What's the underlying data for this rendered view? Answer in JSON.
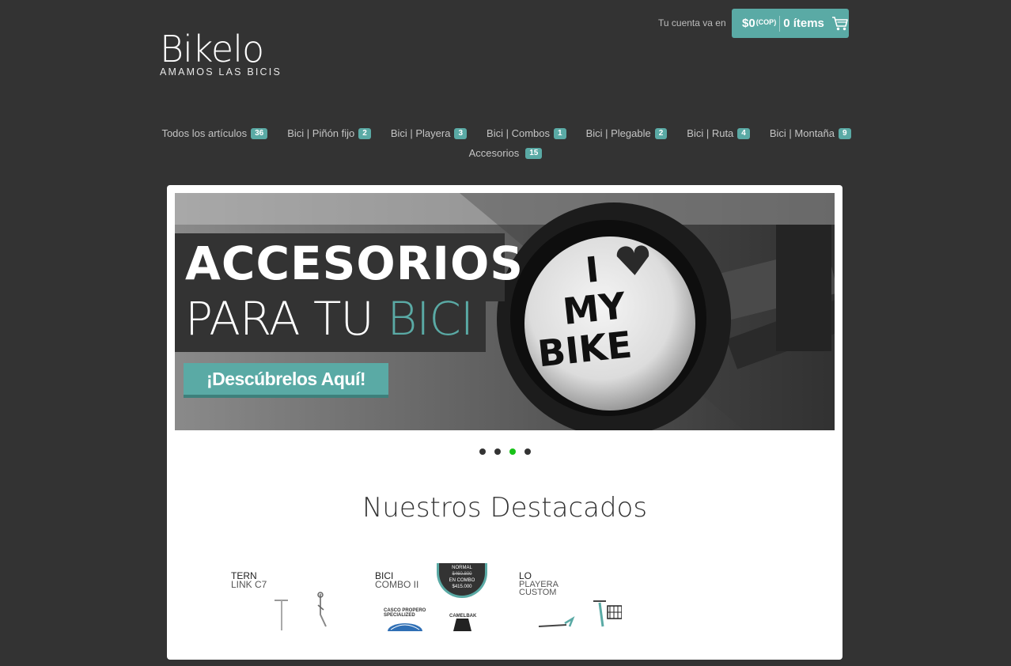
{
  "header": {
    "logo_text": "Bikelo",
    "logo_tagline": "AMAMOS LAS BICIS",
    "account_label": "Tu cuenta va en",
    "cart_amount": "$0",
    "cart_currency": "(COP)",
    "cart_items": "0 ítems"
  },
  "nav": {
    "row1": [
      {
        "label": "Todos los artículos",
        "count": "36"
      },
      {
        "label": "Bici | Piñón fijo",
        "count": "2"
      },
      {
        "label": "Bici | Playera",
        "count": "3"
      },
      {
        "label": "Bici | Combos",
        "count": "1"
      },
      {
        "label": "Bici | Plegable",
        "count": "2"
      },
      {
        "label": "Bici | Ruta",
        "count": "4"
      },
      {
        "label": "Bici | Montaña",
        "count": "9"
      }
    ],
    "row2": [
      {
        "label": "Accesorios",
        "count": "15"
      }
    ]
  },
  "slider": {
    "headline_1": "ACCESORIOS",
    "headline_2a": "PARA TU ",
    "headline_2b": "BICI",
    "bell_text_1": "I",
    "bell_text_2": "MY",
    "bell_text_3": "BIKE",
    "cta_label": "¡Descúbrelos Aquí!",
    "active_slide": 3,
    "slide_count": 4
  },
  "featured": {
    "title": "Nuestros Destacados",
    "products": [
      {
        "line1": "TERN",
        "line2": "LINK C7"
      },
      {
        "line1": "BICI",
        "line2": "COMBO II",
        "badge_1": "NORMAL",
        "badge_2": "$460.800",
        "badge_3": "EN COMBO",
        "badge_4": "$415.000",
        "item_a_1": "CASCO PROPERO",
        "item_a_2": "SPECIALIZED",
        "item_b": "CAMELBAK"
      },
      {
        "line1": "LO",
        "line2": "PLAYERA",
        "line3": "CUSTOM"
      }
    ]
  },
  "colors": {
    "background": "#333333",
    "accent": "#5aaaa5",
    "active_dot": "#18c218"
  }
}
